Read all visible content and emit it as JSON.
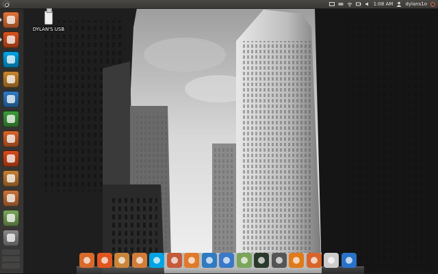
{
  "desktop": {
    "usb_label": "DYLAN'S USB"
  },
  "panel": {
    "clock": "1:08 AM",
    "user": "dylans1o"
  },
  "launcher": {
    "items": [
      {
        "name": "files",
        "icon": "home-folder-icon",
        "color": "#e2743a"
      },
      {
        "name": "firefox",
        "icon": "firefox-icon",
        "color": "#d9531e"
      },
      {
        "name": "skype",
        "icon": "skype-icon",
        "color": "#00a4e4"
      },
      {
        "name": "software-center",
        "icon": "bag-icon",
        "color": "#c9862e"
      },
      {
        "name": "writer",
        "icon": "document-icon",
        "color": "#2f7bc1"
      },
      {
        "name": "calc",
        "icon": "spreadsheet-icon",
        "color": "#3f9b3a"
      },
      {
        "name": "impress",
        "icon": "presentation-icon",
        "color": "#d8642a"
      },
      {
        "name": "ubuntu-one",
        "icon": "ubuntu-one-icon",
        "color": "#d84a1b"
      },
      {
        "name": "gift",
        "icon": "gift-icon",
        "color": "#c57f34"
      },
      {
        "name": "folder",
        "icon": "folder-icon",
        "color": "#c8743a"
      },
      {
        "name": "people",
        "icon": "people-icon",
        "color": "#7aa55a"
      },
      {
        "name": "monitor",
        "icon": "monitor-icon",
        "color": "#888888"
      }
    ]
  },
  "dock": {
    "items": [
      {
        "name": "anchor",
        "icon": "anchor-icon",
        "color": "#d86a2a"
      },
      {
        "name": "firefox",
        "icon": "firefox-icon",
        "color": "#e0561e"
      },
      {
        "name": "gift",
        "icon": "gift-icon",
        "color": "#c9863a"
      },
      {
        "name": "files",
        "icon": "folder-icon",
        "color": "#d27c3a"
      },
      {
        "name": "skype",
        "icon": "skype-icon",
        "color": "#00a4e4"
      },
      {
        "name": "photos",
        "icon": "photo-icon",
        "color": "#c45a3a"
      },
      {
        "name": "audio",
        "icon": "music-icon",
        "color": "#e07a2a"
      },
      {
        "name": "writer",
        "icon": "document-icon",
        "color": "#2f7bc1"
      },
      {
        "name": "empathy",
        "icon": "chat-icon",
        "color": "#3a78c8"
      },
      {
        "name": "people",
        "icon": "people-icon",
        "color": "#7aa55a"
      },
      {
        "name": "monitor",
        "icon": "monitor-icon",
        "color": "#2a3a2a"
      },
      {
        "name": "webcam",
        "icon": "camera-icon",
        "color": "#555555"
      },
      {
        "name": "vlc",
        "icon": "cone-icon",
        "color": "#e07a1a"
      },
      {
        "name": "home",
        "icon": "home-icon",
        "color": "#d8642a"
      },
      {
        "name": "printer",
        "icon": "printer-icon",
        "color": "#cccccc"
      },
      {
        "name": "bluetooth",
        "icon": "bluetooth-icon",
        "color": "#2a72c8"
      }
    ]
  }
}
